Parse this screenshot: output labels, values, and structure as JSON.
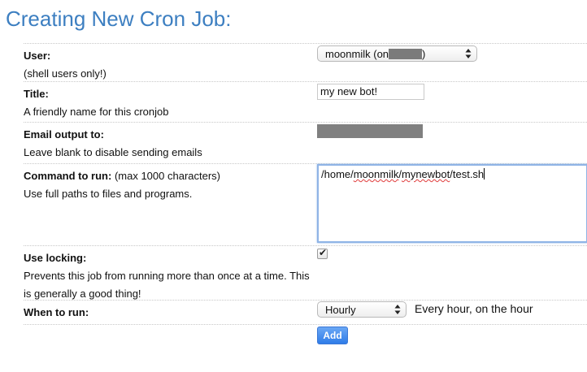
{
  "header": {
    "title": "Creating New Cron Job:"
  },
  "form": {
    "user": {
      "label": "User:",
      "help": "(shell users only!)",
      "selected_prefix": "moonmilk (on",
      "selected_suffix": ")"
    },
    "title": {
      "label": "Title:",
      "help": "A friendly name for this cronjob",
      "value": "my new bot!"
    },
    "email": {
      "label": "Email output to:",
      "help": "Leave blank to disable sending emails"
    },
    "command": {
      "label": "Command to run:",
      "label_note": "(max 1000 characters)",
      "help": "Use full paths to files and programs.",
      "value_parts": [
        "/home/",
        "moonmilk",
        "/",
        "mynewbot",
        "/test.sh"
      ]
    },
    "locking": {
      "label": "Use locking:",
      "help": "Prevents this job from running more than once at a time. This is generally a good thing!",
      "checked": true
    },
    "when": {
      "label": "When to run:",
      "selected": "Hourly",
      "description": "Every hour, on the hour"
    },
    "add_button": "Add"
  },
  "colors": {
    "title": "#3d7fc1",
    "button": "#2f7ce8",
    "focus_border": "#8fb4e6"
  }
}
